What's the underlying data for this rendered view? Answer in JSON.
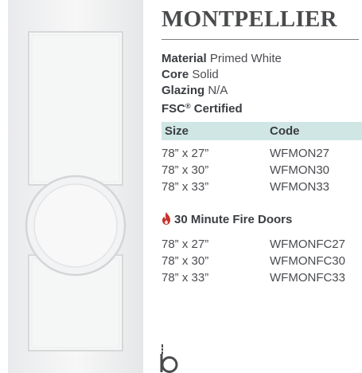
{
  "product": {
    "title": "MONTPELLIER"
  },
  "specs": [
    {
      "label": "Material",
      "value": "Primed White"
    },
    {
      "label": "Core",
      "value": "Solid"
    },
    {
      "label": "Glazing",
      "value": "N/A"
    }
  ],
  "fsc": {
    "prefix": "FSC",
    "mark": "®",
    "suffix": " Certified"
  },
  "table": {
    "col_size": "Size",
    "col_code": "Code",
    "rows": [
      {
        "size": "78” x 27”",
        "code": "WFMON27"
      },
      {
        "size": "78” x 30”",
        "code": "WFMON30"
      },
      {
        "size": "78” x 33”",
        "code": "WFMON33"
      }
    ]
  },
  "fire": {
    "heading": "30 Minute Fire Doors",
    "icon": "flame-icon",
    "icon_color": "#c8312b",
    "rows": [
      {
        "size": "78” x 27”",
        "code": "WFMONFC27"
      },
      {
        "size": "78” x 30”",
        "code": "WFMONFC30"
      },
      {
        "size": "78” x 33”",
        "code": "WFMONFC33"
      }
    ]
  },
  "colors": {
    "table_header_bg": "#cfe6e4",
    "rule": "#7a7d80"
  }
}
